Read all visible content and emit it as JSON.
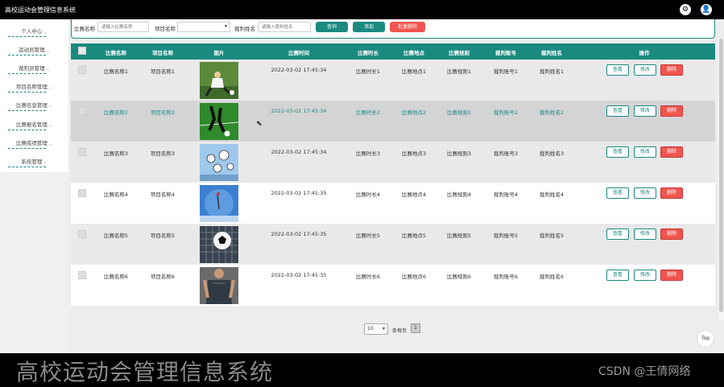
{
  "app": {
    "title": "高校运动会管理信息系统"
  },
  "topbar": {
    "settings_icon": "gear-icon",
    "user_icon": "user-icon"
  },
  "sidebar": {
    "items": [
      {
        "label": "个人中心"
      },
      {
        "label": "运动员管理"
      },
      {
        "label": "裁判员管理"
      },
      {
        "label": "项目名称管理"
      },
      {
        "label": "比赛信息管理"
      },
      {
        "label": "比赛报名管理"
      },
      {
        "label": "比赛成绩管理"
      },
      {
        "label": "系统管理"
      }
    ]
  },
  "search": {
    "match_label": "比赛名称",
    "match_placeholder": "请输入比赛名称",
    "project_label": "项目名称",
    "project_value": "",
    "referee_label": "裁判姓名",
    "referee_placeholder": "请输入裁判姓名",
    "query_button": "查询",
    "add_button": "添加",
    "batch_delete_button": "批量删除"
  },
  "table": {
    "columns": [
      "比赛名称",
      "项目名称",
      "图片",
      "比赛时间",
      "比赛时长",
      "比赛地点",
      "比赛规则",
      "裁判账号",
      "裁判姓名",
      "操作"
    ],
    "rows": [
      {
        "name": "比赛名称1",
        "project": "项目名称1",
        "time": "2022-03-02 17:45:34",
        "duration": "比赛时长1",
        "place": "比赛地点1",
        "rule": "比赛规则1",
        "account": "裁判账号1",
        "referee": "裁判姓名1"
      },
      {
        "name": "比赛名称2",
        "project": "项目名称2",
        "time": "2022-03-02 17:45:34",
        "duration": "比赛时长2",
        "place": "比赛地点2",
        "rule": "比赛规则2",
        "account": "裁判账号2",
        "referee": "裁判姓名2"
      },
      {
        "name": "比赛名称3",
        "project": "项目名称3",
        "time": "2022-03-02 17:45:34",
        "duration": "比赛时长3",
        "place": "比赛地点3",
        "rule": "比赛规则3",
        "account": "裁判账号3",
        "referee": "裁判姓名3"
      },
      {
        "name": "比赛名称4",
        "project": "项目名称4",
        "time": "2022-03-02 17:45:35",
        "duration": "比赛时长4",
        "place": "比赛地点4",
        "rule": "比赛规则4",
        "account": "裁判账号4",
        "referee": "裁判姓名4"
      },
      {
        "name": "比赛名称5",
        "project": "项目名称5",
        "time": "2022-03-02 17:45:35",
        "duration": "比赛时长5",
        "place": "比赛地点5",
        "rule": "比赛规则5",
        "account": "裁判账号5",
        "referee": "裁判姓名5"
      },
      {
        "name": "比赛名称6",
        "project": "项目名称6",
        "time": "2022-03-02 17:45:35",
        "duration": "比赛时长6",
        "place": "比赛地点6",
        "rule": "比赛规则6",
        "account": "裁判账号6",
        "referee": "裁判姓名6"
      }
    ],
    "actions": {
      "view": "查看",
      "edit": "修改",
      "delete": "删除"
    }
  },
  "pagination": {
    "page_size": "10",
    "page_size_label": "条每页",
    "current_page": "1"
  },
  "back_to_top": "Top",
  "banner": {
    "title": "高校运动会管理信息系统",
    "watermark": "CSDN @王倩网络"
  },
  "colors": {
    "accent": "#1a8a80",
    "danger": "#f0554f"
  }
}
